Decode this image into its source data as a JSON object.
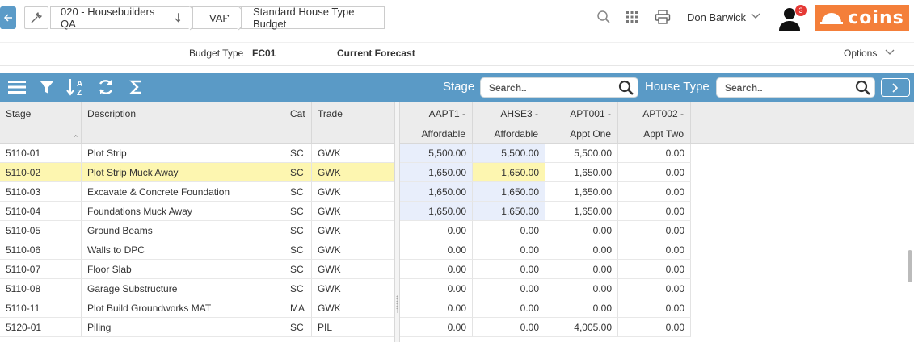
{
  "header": {
    "breadcrumbs": [
      "020 - Housebuilders QA",
      "VAP",
      "Standard House Type Budget"
    ],
    "user_name": "Don Barwick",
    "notification_count": "3",
    "logo_text": "coins",
    "colors": {
      "accent": "#5a9ac6",
      "logo_bg": "#f47f3a",
      "badge": "#e53935"
    }
  },
  "info": {
    "budget_type_label": "Budget Type",
    "budget_type_code": "FC01",
    "budget_type_name": "Current Forecast",
    "options_label": "Options"
  },
  "toolbar": {
    "icons": [
      "menu-icon",
      "filter-icon",
      "sort-az-icon",
      "refresh-icon",
      "sigma-icon"
    ],
    "stage_label": "Stage",
    "stage_placeholder": "Search..",
    "house_type_label": "House Type",
    "house_type_placeholder": "Search.."
  },
  "grid": {
    "left_columns": [
      "Stage",
      "Description",
      "Cat",
      "Trade"
    ],
    "right_columns": [
      {
        "line1": "AAPT1 -",
        "line2": "Affordable"
      },
      {
        "line1": "AHSE3 -",
        "line2": "Affordable"
      },
      {
        "line1": "APT001 -",
        "line2": "Appt One"
      },
      {
        "line1": "APT002 -",
        "line2": "Appt Two"
      }
    ],
    "rows": [
      {
        "stage": "5110-01",
        "description": "Plot Strip",
        "cat": "SC",
        "trade": "GWK",
        "values": [
          "5,500.00",
          "5,500.00",
          "5,500.00",
          "0.00"
        ]
      },
      {
        "stage": "5110-02",
        "description": "Plot Strip Muck Away",
        "cat": "SC",
        "trade": "GWK",
        "values": [
          "1,650.00",
          "1,650.00",
          "1,650.00",
          "0.00"
        ]
      },
      {
        "stage": "5110-03",
        "description": "Excavate & Concrete Foundation",
        "cat": "SC",
        "trade": "GWK",
        "values": [
          "1,650.00",
          "1,650.00",
          "1,650.00",
          "0.00"
        ]
      },
      {
        "stage": "5110-04",
        "description": "Foundations Muck Away",
        "cat": "SC",
        "trade": "GWK",
        "values": [
          "1,650.00",
          "1,650.00",
          "1,650.00",
          "0.00"
        ]
      },
      {
        "stage": "5110-05",
        "description": "Ground Beams",
        "cat": "SC",
        "trade": "GWK",
        "values": [
          "0.00",
          "0.00",
          "0.00",
          "0.00"
        ]
      },
      {
        "stage": "5110-06",
        "description": "Walls to DPC",
        "cat": "SC",
        "trade": "GWK",
        "values": [
          "0.00",
          "0.00",
          "0.00",
          "0.00"
        ]
      },
      {
        "stage": "5110-07",
        "description": "Floor Slab",
        "cat": "SC",
        "trade": "GWK",
        "values": [
          "0.00",
          "0.00",
          "0.00",
          "0.00"
        ]
      },
      {
        "stage": "5110-08",
        "description": "Garage Substructure",
        "cat": "SC",
        "trade": "GWK",
        "values": [
          "0.00",
          "0.00",
          "0.00",
          "0.00"
        ]
      },
      {
        "stage": "5110-11",
        "description": "Plot Build Groundworks MAT",
        "cat": "MA",
        "trade": "GWK",
        "values": [
          "0.00",
          "0.00",
          "0.00",
          "0.00"
        ]
      },
      {
        "stage": "5120-01",
        "description": "Piling",
        "cat": "SC",
        "trade": "PIL",
        "values": [
          "0.00",
          "0.00",
          "4,005.00",
          "0.00"
        ]
      }
    ],
    "selected_row": 1,
    "row_colors": {
      "selected": "#fdf6b0",
      "blue_cell": "#e8eefb"
    }
  }
}
